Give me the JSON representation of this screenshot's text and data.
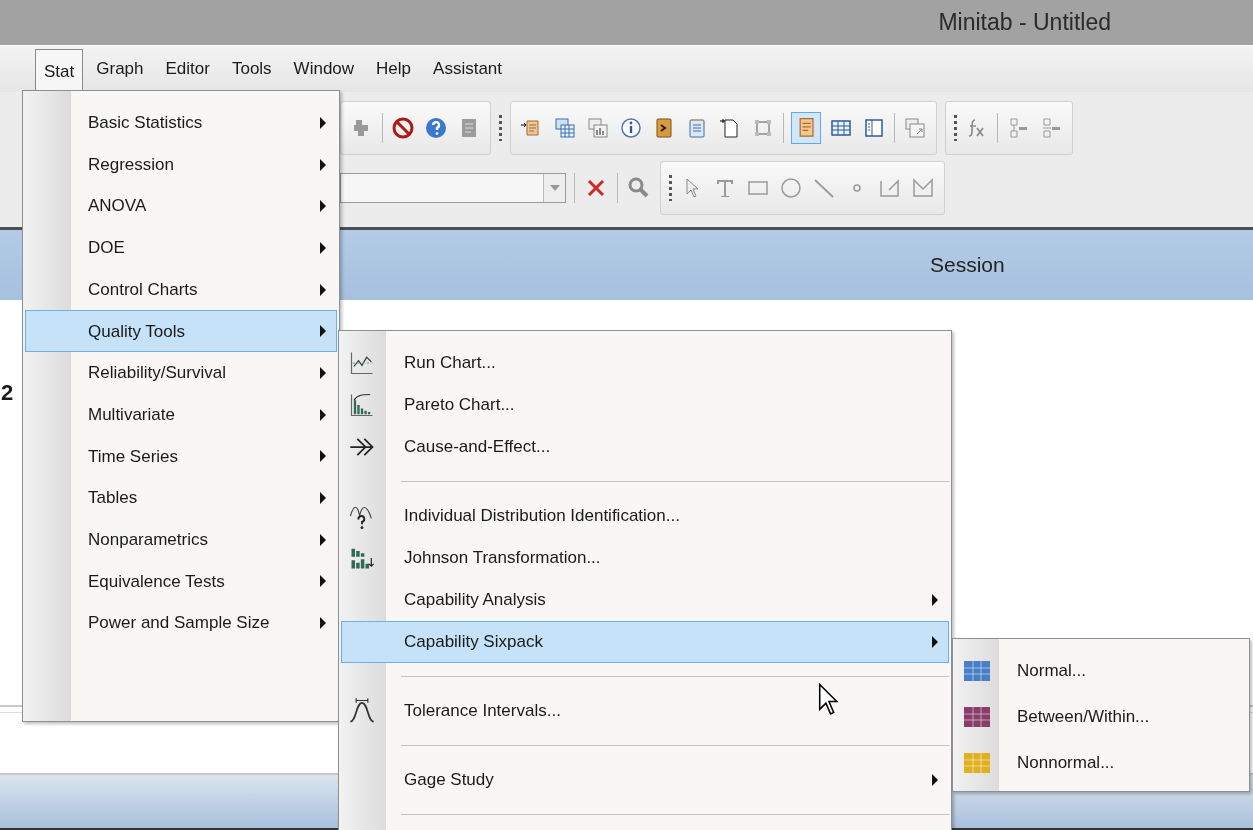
{
  "window": {
    "title": "Minitab - Untitled"
  },
  "menubar": [
    {
      "label": "Stat",
      "selected": true
    },
    {
      "label": "Graph",
      "selected": false
    },
    {
      "label": "Editor",
      "selected": false
    },
    {
      "label": "Tools",
      "selected": false
    },
    {
      "label": "Window",
      "selected": false
    },
    {
      "label": "Help",
      "selected": false
    },
    {
      "label": "Assistant",
      "selected": false
    }
  ],
  "session": {
    "title": "Session",
    "text": "2"
  },
  "stat_menu": [
    {
      "label": "Basic Statistics",
      "submenu": true,
      "selected": false
    },
    {
      "label": "Regression",
      "submenu": true,
      "selected": false
    },
    {
      "label": "ANOVA",
      "submenu": true,
      "selected": false
    },
    {
      "label": "DOE",
      "submenu": true,
      "selected": false
    },
    {
      "label": "Control Charts",
      "submenu": true,
      "selected": false
    },
    {
      "label": "Quality Tools",
      "submenu": true,
      "selected": true
    },
    {
      "label": "Reliability/Survival",
      "submenu": true,
      "selected": false
    },
    {
      "label": "Multivariate",
      "submenu": true,
      "selected": false
    },
    {
      "label": "Time Series",
      "submenu": true,
      "selected": false
    },
    {
      "label": "Tables",
      "submenu": true,
      "selected": false
    },
    {
      "label": "Nonparametrics",
      "submenu": true,
      "selected": false
    },
    {
      "label": "Equivalence Tests",
      "submenu": true,
      "selected": false
    },
    {
      "label": "Power and Sample Size",
      "submenu": true,
      "selected": false
    }
  ],
  "quality_tools_menu": [
    {
      "kind": "item",
      "label": "Run Chart...",
      "submenu": false,
      "selected": false
    },
    {
      "kind": "item",
      "label": "Pareto Chart...",
      "submenu": false,
      "selected": false
    },
    {
      "kind": "item",
      "label": "Cause-and-Effect...",
      "submenu": false,
      "selected": false
    },
    {
      "kind": "separator"
    },
    {
      "kind": "item",
      "label": "Individual Distribution Identification...",
      "submenu": false,
      "selected": false
    },
    {
      "kind": "item",
      "label": "Johnson Transformation...",
      "submenu": false,
      "selected": false
    },
    {
      "kind": "item",
      "label": "Capability Analysis",
      "submenu": true,
      "selected": false
    },
    {
      "kind": "item",
      "label": "Capability Sixpack",
      "submenu": true,
      "selected": true
    },
    {
      "kind": "separator"
    },
    {
      "kind": "item",
      "label": "Tolerance Intervals...",
      "submenu": false,
      "selected": false
    },
    {
      "kind": "separator"
    },
    {
      "kind": "item",
      "label": "Gage Study",
      "submenu": true,
      "selected": false
    },
    {
      "kind": "separator"
    }
  ],
  "sixpack_menu": [
    {
      "label": "Normal...",
      "color": "#4a7fc8",
      "selected": false
    },
    {
      "label": "Between/Within...",
      "color": "#8a3d6a",
      "selected": false
    },
    {
      "label": "Nonnormal...",
      "color": "#e0b020",
      "selected": false
    }
  ]
}
